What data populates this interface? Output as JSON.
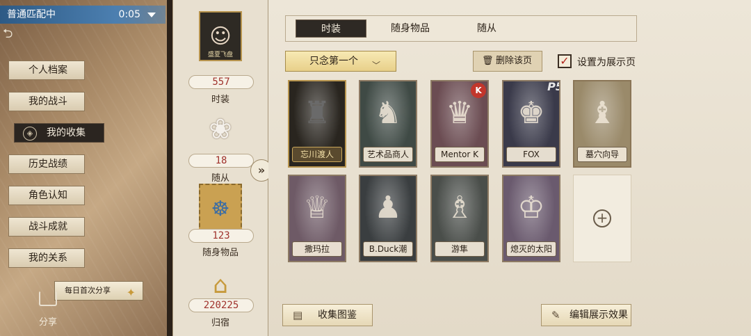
{
  "matchmaking": {
    "label": "普通匹配中",
    "timer": "0:05"
  },
  "sidebar": {
    "items": [
      {
        "label": "个人档案"
      },
      {
        "label": "我的战斗"
      },
      {
        "label": "我的收集"
      },
      {
        "label": "历史战绩"
      },
      {
        "label": "角色认知"
      },
      {
        "label": "战斗成就"
      },
      {
        "label": "我的关系"
      }
    ],
    "active_index": 2
  },
  "daily_share": {
    "label": "每日首次分享"
  },
  "share": {
    "label": "分享"
  },
  "stats": {
    "showcase_caption": "盛夏飞盘",
    "costumes": {
      "count": "557",
      "label": "时装"
    },
    "followers": {
      "count": "18",
      "label": "随从"
    },
    "accessories": {
      "count": "123",
      "label": "随身物品"
    },
    "homes": {
      "count": "220225",
      "label": "归宿"
    }
  },
  "tabs": [
    {
      "label": "时装"
    },
    {
      "label": "随身物品"
    },
    {
      "label": "随从"
    }
  ],
  "filter": {
    "selected": "只念第一个"
  },
  "actions": {
    "delete_page": "删除该页",
    "set_showcase": "设置为展示页",
    "collection_guide": "收集图鉴",
    "edit_display": "编辑展示效果"
  },
  "cards": [
    {
      "name": "忘川渡人"
    },
    {
      "name": "艺术品商人"
    },
    {
      "name": "Mentor K"
    },
    {
      "name": "FOX"
    },
    {
      "name": "墓穴向导"
    },
    {
      "name": "撒玛拉"
    },
    {
      "name": "B.Duck潮"
    },
    {
      "name": "游隼"
    },
    {
      "name": "熄灭的太阳"
    }
  ],
  "colors": {
    "accent_red": "#a0332d",
    "gold": "#b7944e",
    "dark_tab": "#2e2924"
  }
}
